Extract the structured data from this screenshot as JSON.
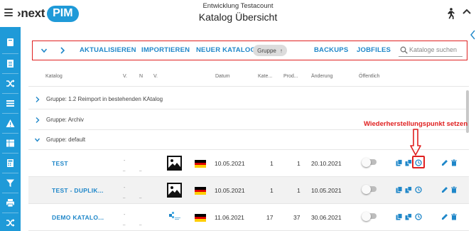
{
  "header": {
    "logo_text": "›next",
    "logo_pim": "PIM",
    "account": "Entwicklung Testacount",
    "title": "Katalog Übersicht"
  },
  "toolbar": {
    "aktualisieren": "AKTUALISIEREN",
    "importieren": "IMPORTIEREN",
    "neuer_katalog": "NEUER KATALOG",
    "gruppe_chip": "Gruppe",
    "gruppe_chip_arrow": "↑",
    "backups": "BACKUPS",
    "jobfiles": "JOBFILES",
    "search_placeholder": "Kataloge suchen"
  },
  "table": {
    "columns": {
      "katalog": "Katalog",
      "v1": "V.",
      "n": "N",
      "v2": "V.",
      "datum": "Datum",
      "kategorien": "Kate...",
      "produkte": "Prod...",
      "aenderung": "Änderung",
      "oeffentlich": "Öffentlich"
    },
    "groups": [
      {
        "label": "Gruppe: 1.2 Reimport in bestehenden KAtalog"
      },
      {
        "label": "Gruppe: Archiv"
      },
      {
        "label": "Gruppe: default"
      }
    ],
    "rows": [
      {
        "name": "TEST",
        "v1": "-",
        "v1_sub": "_",
        "n": "_",
        "datum": "10.05.2021",
        "kategorien": "1",
        "produkte": "1",
        "aenderung": "20.10.2021",
        "thumb": "image-placeholder"
      },
      {
        "name": "TEST - DUPLIK...",
        "v1": "-",
        "v1_sub": "_",
        "n": "_",
        "datum": "10.05.2021",
        "kategorien": "1",
        "produkte": "1",
        "aenderung": "10.05.2021",
        "thumb": "image-placeholder"
      },
      {
        "name": "DEMO KATALO...",
        "v1": "-",
        "v1_sub": "_",
        "n": "_",
        "datum": "11.06.2021",
        "kategorien": "17",
        "produkte": "37",
        "aenderung": "30.06.2021",
        "thumb": "logo-thumbnail"
      }
    ]
  },
  "annotation": {
    "text": "Wiederherstellungspunkt setzen"
  },
  "colors": {
    "brand": "#1f9ad8",
    "link": "#1f87c9",
    "highlight": "#e02020",
    "flag": [
      "#000000",
      "#dd0000",
      "#ffce00"
    ]
  }
}
